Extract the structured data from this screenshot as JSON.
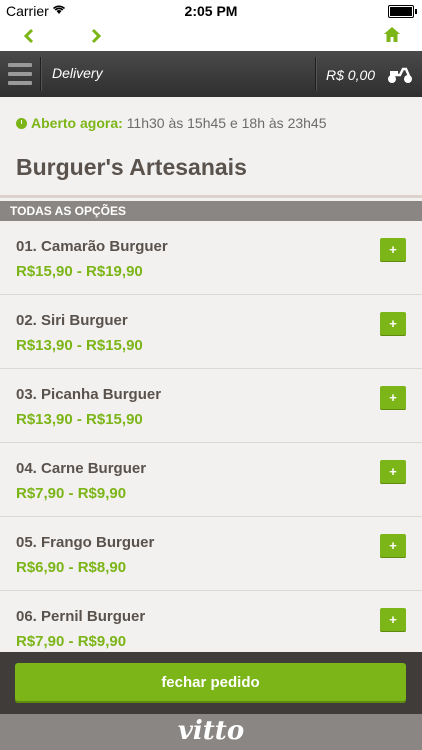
{
  "status_bar": {
    "carrier": "Carrier",
    "time": "2:05 PM"
  },
  "nav": {
    "back_icon": "chevron-left-icon",
    "forward_icon": "chevron-right-icon",
    "home_icon": "home-icon"
  },
  "header": {
    "section_label": "Delivery",
    "cart_total": "R$ 0,00",
    "cart_icon": "scooter-icon"
  },
  "store": {
    "open_label": "Aberto agora:",
    "hours": "11h30 às 15h45 e 18h às 23h45",
    "category_title": "Burguer's Artesanais"
  },
  "section_header": "TODAS AS OPÇÕES",
  "items": [
    {
      "name": "01. Camarão Burguer",
      "price": "R$15,90 - R$19,90",
      "add_label": "+"
    },
    {
      "name": "02. Siri Burguer",
      "price": "R$13,90 - R$15,90",
      "add_label": "+"
    },
    {
      "name": "03. Picanha Burguer",
      "price": "R$13,90 - R$15,90",
      "add_label": "+"
    },
    {
      "name": "04. Carne Burguer",
      "price": "R$7,90 - R$9,90",
      "add_label": "+"
    },
    {
      "name": "05. Frango Burguer",
      "price": "R$6,90 - R$8,90",
      "add_label": "+"
    },
    {
      "name": "06. Pernil Burguer",
      "price": "R$7,90 - R$9,90",
      "add_label": "+"
    }
  ],
  "checkout_label": "fechar pedido",
  "brand_logo": "vitto",
  "colors": {
    "accent": "#7cb518",
    "dark_bar": "#403c3a",
    "title": "#5a524d"
  }
}
